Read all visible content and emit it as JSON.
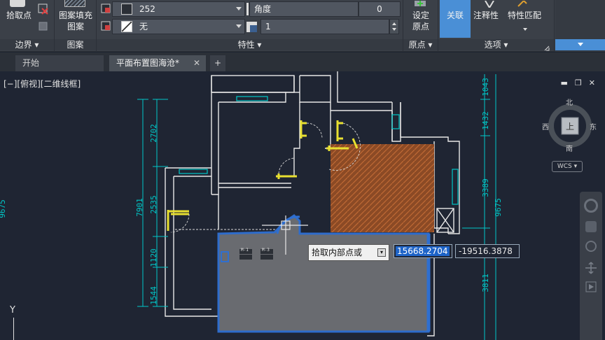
{
  "ribbon": {
    "boundary": {
      "pick_point_label": "拾取点",
      "title": "边界"
    },
    "pattern": {
      "fill_pattern_label": "图案填充\n图案",
      "title": "图案"
    },
    "properties": {
      "color_value": "252",
      "transparency_label": "角度",
      "transparency_value": "0",
      "bg_value": "无",
      "scale_value": "1",
      "title": "特性"
    },
    "origin": {
      "set_origin_label": "设定\n原点",
      "title": "原点"
    },
    "options": {
      "associative_label": "关联",
      "annotative_label": "注释性",
      "match_label": "特性匹配",
      "title": "选项"
    }
  },
  "tabs": [
    {
      "label": "开始"
    },
    {
      "label": "平面布置图海沧*"
    }
  ],
  "viewport": {
    "view_label": "[−][俯视][二维线框]",
    "compass": {
      "north": "北",
      "south": "南",
      "east": "东",
      "west": "西",
      "top": "上",
      "wcs": "WCS"
    },
    "axis_y": "Y",
    "dims_left": [
      "2702",
      "7901",
      "2535",
      "1120",
      "1544",
      "9675"
    ],
    "dims_right": [
      "1043",
      "1432",
      "3389",
      "9675",
      "3811"
    ],
    "door_tags": [
      "M-1",
      "M-3"
    ],
    "prompt": {
      "label": "拾取内部点或",
      "x_value": "15668.2704",
      "y_value": "-19516.3878"
    }
  },
  "colors": {
    "accent": "#4a8fd6",
    "wall": "#e8e8e8",
    "dim": "#00c8c8",
    "hatch": "#8b4a25",
    "selection": "#2f6fd0"
  }
}
